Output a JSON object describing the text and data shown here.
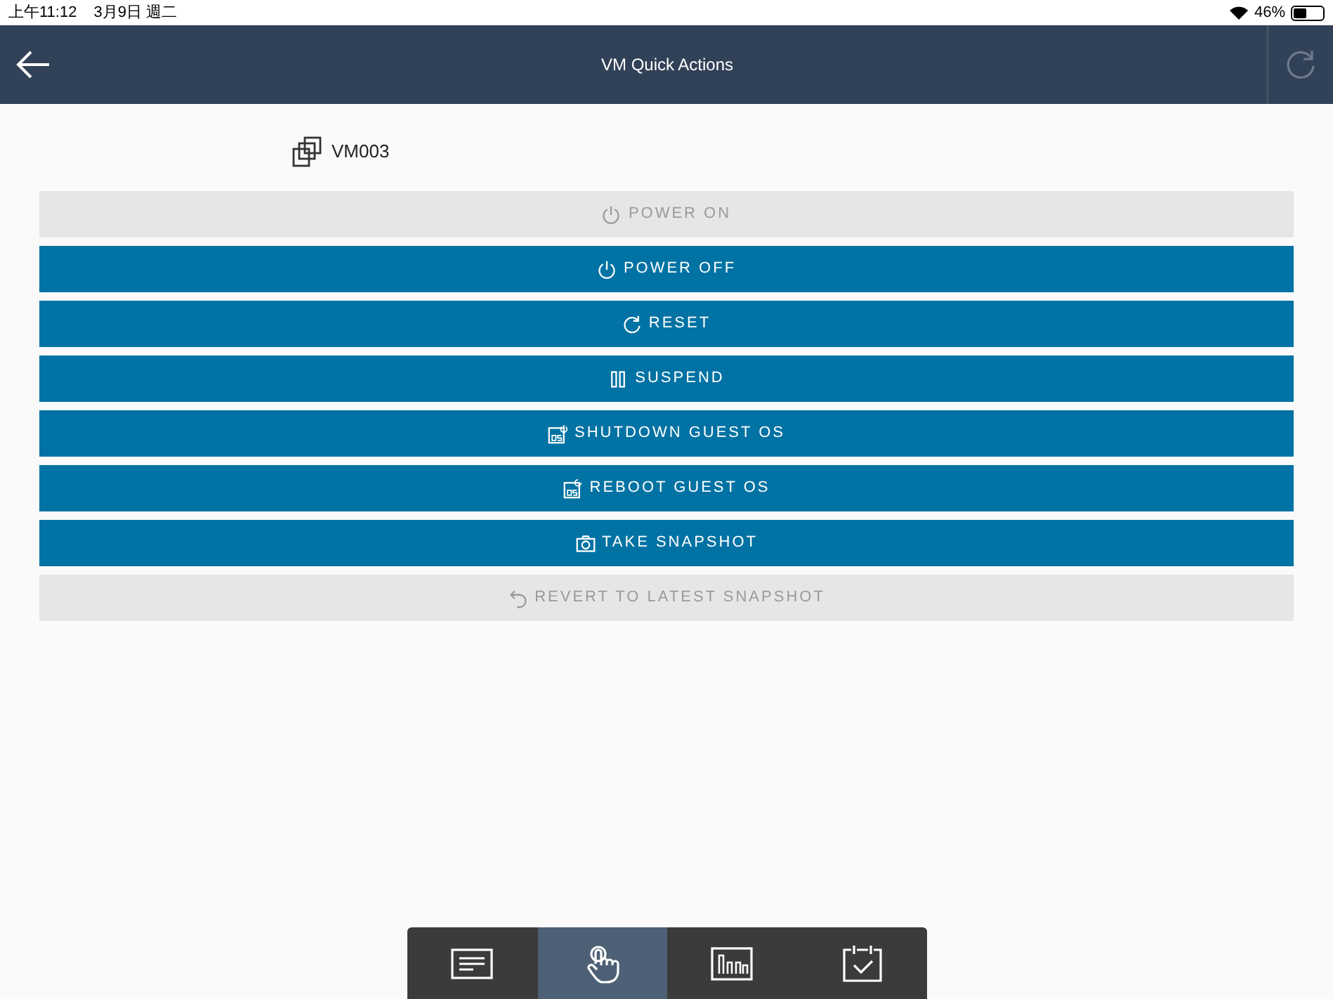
{
  "status_bar": {
    "time": "上午11:12",
    "date": "3月9日 週二",
    "battery": "46%"
  },
  "header": {
    "title": "VM Quick Actions"
  },
  "vm": {
    "name": "VM003"
  },
  "actions": [
    {
      "label": "POWER ON",
      "kind": "power",
      "disabled": true
    },
    {
      "label": "POWER OFF",
      "kind": "power",
      "disabled": false
    },
    {
      "label": "RESET",
      "kind": "reset",
      "disabled": false
    },
    {
      "label": "SUSPEND",
      "kind": "pause",
      "disabled": false
    },
    {
      "label": "SHUTDOWN GUEST OS",
      "kind": "os-shutdown",
      "disabled": false
    },
    {
      "label": "REBOOT GUEST OS",
      "kind": "os-reboot",
      "disabled": false
    },
    {
      "label": "TAKE SNAPSHOT",
      "kind": "camera",
      "disabled": false
    },
    {
      "label": "REVERT TO LATEST SNAPSHOT",
      "kind": "revert",
      "disabled": true
    }
  ],
  "tabs": [
    {
      "kind": "summary",
      "selected": false
    },
    {
      "kind": "actions",
      "selected": true
    },
    {
      "kind": "monitor",
      "selected": false
    },
    {
      "kind": "tasks",
      "selected": false
    }
  ]
}
